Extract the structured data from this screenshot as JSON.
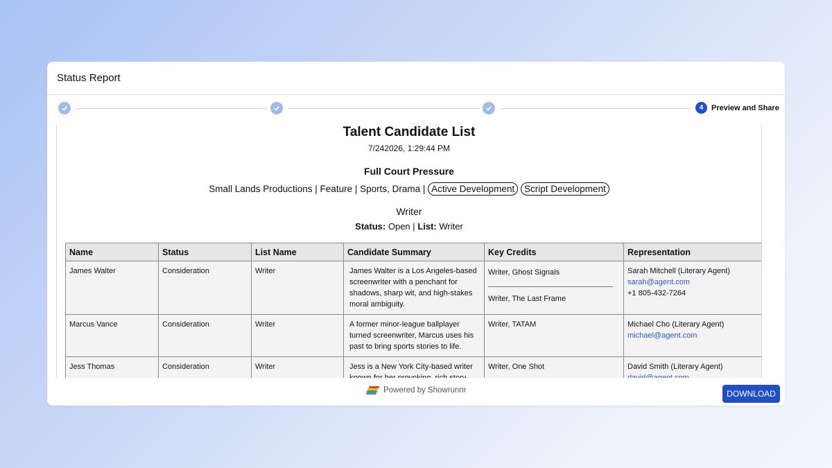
{
  "header": {
    "title": "Status Report"
  },
  "stepper": {
    "active_step_number": "4",
    "active_step_label": "Preview and Share",
    "completed_steps": 3,
    "icons": [
      "check-circle-icon",
      "check-circle-icon",
      "check-circle-icon"
    ]
  },
  "document": {
    "title": "Talent Candidate List",
    "date": "7/242026, 1:29:44 PM",
    "project_title": "Full Court Pressure",
    "project_meta": "Small Lands Productions | Feature | Sports, Drama |",
    "tags": [
      "Active Development",
      "Script Development"
    ],
    "role": "Writer",
    "status_label": "Status:",
    "status_value": "Open",
    "separator": "|",
    "list_label": "List:",
    "list_value": "Writer"
  },
  "table": {
    "headers": [
      "Name",
      "Status",
      "List Name",
      "Candidate Summary",
      "Key Credits",
      "Representation"
    ],
    "rows": [
      {
        "name": "James Walter",
        "status": "Consideration",
        "list_name": "Writer",
        "summary": "James Walter is a Los Angeles-based screenwriter with a penchant for shadows, sharp wit, and high-stakes moral ambiguity.",
        "credits": [
          "Writer, Ghost Signals",
          "Writer, The Last Frame"
        ],
        "rep_name": "Sarah Mitchell (Literary Agent)",
        "rep_email": "sarah@agent.com",
        "rep_phone": "+1 805-432-7264"
      },
      {
        "name": "Marcus Vance",
        "status": "Consideration",
        "list_name": "Writer",
        "summary": "A former minor-league ballplayer turned screenwriter, Marcus uses his past to bring sports stories to life.",
        "credits": [
          "Writer, TATAM"
        ],
        "rep_name": "Michael Cho (Literary Agent)",
        "rep_email": "michael@agent.com",
        "rep_phone": ""
      },
      {
        "name": "Jess Thomas",
        "status": "Consideration",
        "list_name": "Writer",
        "summary": "Jess is a New York City-based writer known for her provoking, rich story-",
        "credits": [
          "Writer, One Shot"
        ],
        "rep_name": "David Smith (Literary Agent)",
        "rep_email": "david@agent.com",
        "rep_phone": ""
      }
    ]
  },
  "footer": {
    "powered_by": "Powered by Showrunnr",
    "logo_icon": "showrunnr-logo-icon",
    "download_label": "DOWNLOAD"
  },
  "colors": {
    "accent": "#1f4fc4",
    "completed_step": "#9fbbea",
    "link": "#2f58c8",
    "logo_stripes": [
      "#e94235",
      "#fbbc05",
      "#34a853",
      "#4285f4"
    ]
  }
}
